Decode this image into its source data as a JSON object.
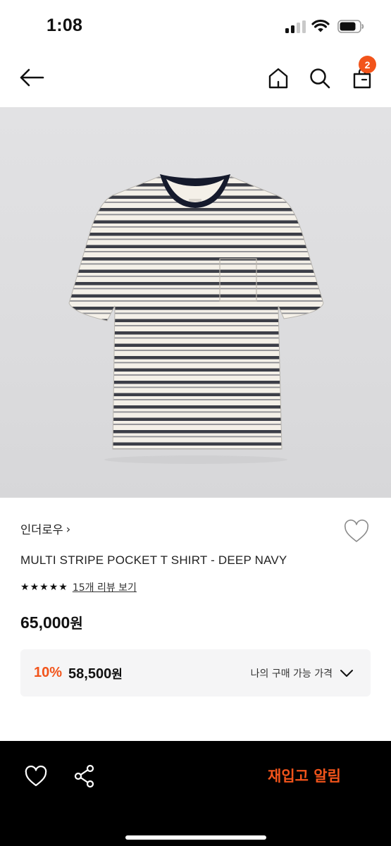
{
  "status_bar": {
    "time": "1:08"
  },
  "nav": {
    "back_icon": "arrow-left-icon",
    "home_icon": "home-icon",
    "search_icon": "search-icon",
    "bag_icon": "shopping-bag-icon",
    "cart_count": "2"
  },
  "product": {
    "image": "striped-tshirt-photo",
    "brand": "인더로우",
    "brand_chevron": "›",
    "title": "MULTI STRIPE POCKET T SHIRT - DEEP NAVY",
    "rating_stars": 5,
    "star_glyph": "★",
    "review_link": "15개 리뷰 보기",
    "price": "65,000",
    "currency": "원"
  },
  "my_price": {
    "discount": "10%",
    "sale_price": "58,500",
    "currency": "원",
    "label": "나의 구매 가능 가격"
  },
  "bottom_bar": {
    "wish_icon": "heart-outline-icon",
    "share_icon": "share-icon",
    "restock_label": "재입고 알림"
  },
  "colors": {
    "accent": "#f2541b",
    "bottom_bar_bg": "#000000",
    "price_box_bg": "#f5f5f6"
  }
}
